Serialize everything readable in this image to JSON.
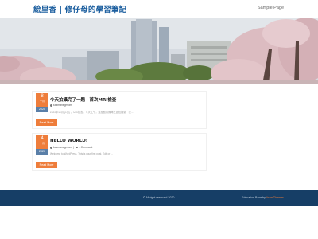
{
  "header": {
    "site_title": "絵里香 | 修仔母的學習筆記",
    "nav_item": "Sample Page"
  },
  "posts": [
    {
      "day": "8",
      "month": "十月",
      "year": "2020",
      "title": "今天拍攝完了一題｜首次MRI檢查",
      "author": "kazmanegmomi",
      "comments": "",
      "excerpt": "2020年10月 (1日) ，MRI檢查，今天上午，這是醫療團隊之邀拍攝第一次...",
      "read_more": "Read More"
    },
    {
      "day": "4",
      "month": "十月",
      "year": "2020",
      "title": "HELLO WORLD!",
      "author": "kazmanegmomi",
      "comments": "1 Comment",
      "excerpt": "Welcome to WordPress. This is your first post. Edit or ...",
      "read_more": "Read More"
    }
  ],
  "footer": {
    "copyright": "© All right reserved 2020",
    "credit_prefix": "Education Base by",
    "credit_link": "Ashe Themes"
  },
  "colors": {
    "title": "#1a5d9e",
    "accent": "#ee7d3b",
    "date_year": "#5a7fa8",
    "footer": "#163e66"
  }
}
